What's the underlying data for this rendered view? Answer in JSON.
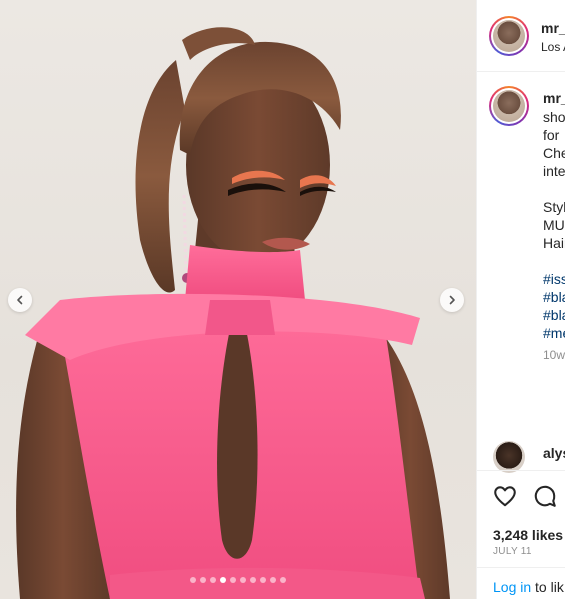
{
  "post": {
    "carousel": {
      "slide_count": 10,
      "active_slide": 3
    },
    "header": {
      "username": "mr_",
      "location": "Los A"
    },
    "caption": {
      "username": "mr_",
      "lines": [
        "sho",
        "for",
        "Che",
        "inte"
      ],
      "credits": [
        "Styl",
        "MU:",
        "Hair"
      ],
      "hashtags": [
        "#iss",
        "#bla",
        "#bla",
        "#me"
      ],
      "time_ago": "10w"
    },
    "comment": {
      "username": "alys"
    },
    "actions": {
      "like_icon": "heart-icon",
      "comment_icon": "comment-icon"
    },
    "likes": "3,248 likes",
    "date": "JULY 11",
    "login": {
      "link": "Log in",
      "rest": " to lik"
    }
  },
  "colors": {
    "link": "#0095f6",
    "hashtag": "#00376b",
    "muted": "#8e8e8e",
    "dress": "#f45f8c"
  }
}
